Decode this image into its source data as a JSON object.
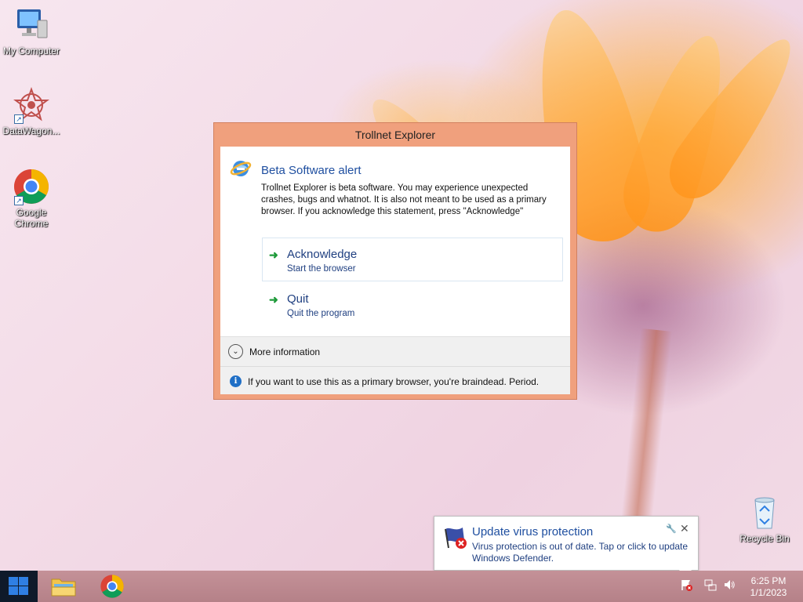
{
  "desktop": {
    "icons": [
      {
        "label": "My Computer",
        "icon": "computer-icon"
      },
      {
        "label": "DataWagon...",
        "icon": "datawagon-icon"
      },
      {
        "label": "Google Chrome",
        "icon": "chrome-icon"
      },
      {
        "label": "Recycle Bin",
        "icon": "recycle-bin-icon"
      }
    ]
  },
  "dialog": {
    "title": "Trollnet Explorer",
    "alert_title": "Beta Software alert",
    "alert_text": "Trollnet Explorer is beta software. You may experience unexpected crashes, bugs and whatnot. It is also not meant to be used as a primary browser. If you acknowledge this statement, press \"Acknowledge\"",
    "commands": [
      {
        "label": "Acknowledge",
        "sub": "Start the browser"
      },
      {
        "label": "Quit",
        "sub": "Quit the program"
      }
    ],
    "more_info": "More information",
    "footer_text": "If you want to use this as a primary browser, you're braindead. Period."
  },
  "notification": {
    "title": "Update virus protection",
    "message": "Virus protection is out of date. Tap or click to update Windows Defender."
  },
  "taskbar": {
    "clock_time": "6:25 PM",
    "clock_date": "1/1/2023"
  },
  "colors": {
    "accent_blue": "#1f4fa0",
    "dialog_frame": "#f0a07d",
    "start_logo": "#2f7fe3"
  }
}
